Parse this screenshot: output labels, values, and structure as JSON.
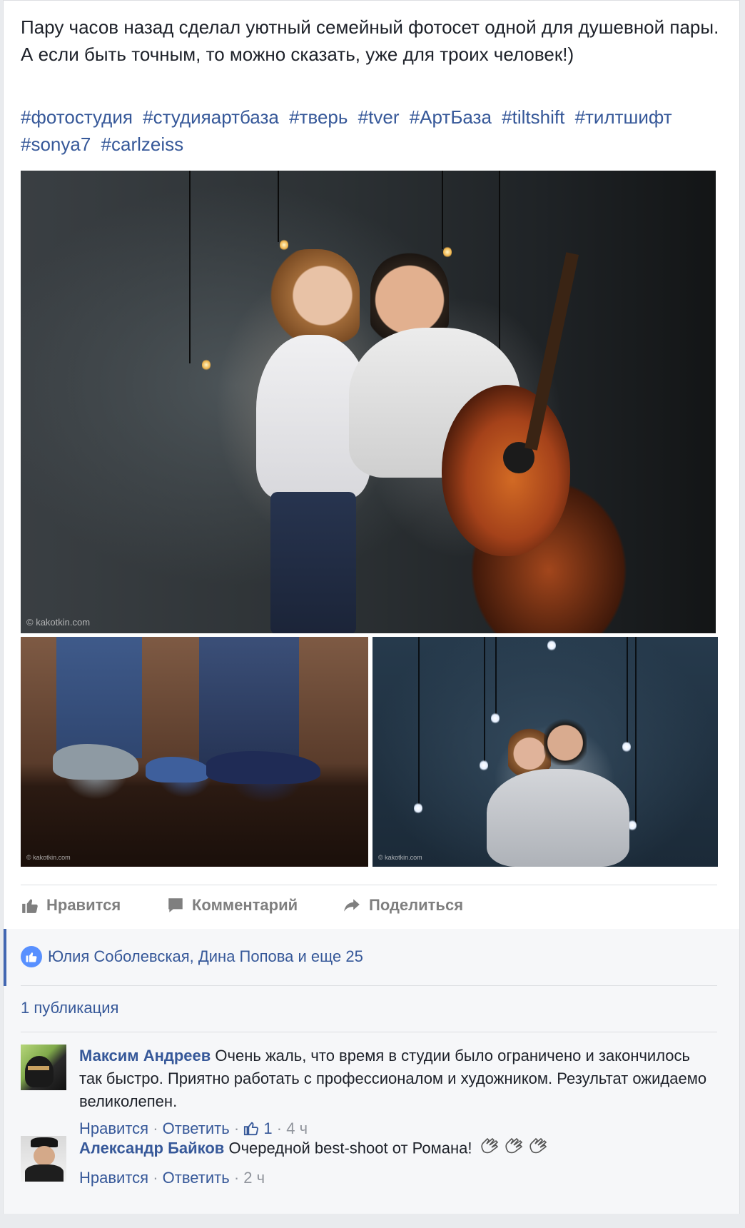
{
  "post": {
    "text": "Пару часов назад сделал уютный семейный фотосет одной для душевной пары. А если быть точным, то можно сказать, уже для троих человек!)",
    "hashtags": [
      "#фотостудия",
      "#студияартбаза",
      "#тверь",
      "#tver",
      "#АртБаза",
      "#tiltshift",
      "#тилтшифт",
      "#sonya7",
      "#carlzeiss"
    ],
    "photos": {
      "main_watermark": "© kakotkin.com",
      "left_watermark": "© kakotkin.com",
      "right_watermark": "© kakotkin.com"
    }
  },
  "actions": {
    "like": "Нравится",
    "comment": "Комментарий",
    "share": "Поделиться"
  },
  "likes_summary": "Юлия Соболевская, Дина Попова и еще 25",
  "shares_count_label": "1 публикация",
  "comments": [
    {
      "author": "Максим Андреев",
      "text": "Очень жаль, что время в студии было ограничено и закончилось так быстро. Приятно работать с профессионалом и художником. Результат ожидаемо великолепен.",
      "like_label": "Нравится",
      "reply_label": "Ответить",
      "like_count": "1",
      "time": "4 ч"
    },
    {
      "author": "Александр Байков",
      "text": "Очередной best-shoot от Романа!",
      "like_label": "Нравится",
      "reply_label": "Ответить",
      "time": "2 ч",
      "emoji": [
        "clapping-hands",
        "clapping-hands",
        "clapping-hands"
      ]
    }
  ],
  "colors": {
    "link": "#365899",
    "text": "#1d2129",
    "muted": "#90949c",
    "action_gray": "#7f7f7f",
    "like_badge": "#5890ff",
    "page_bg": "#e9ebee"
  }
}
